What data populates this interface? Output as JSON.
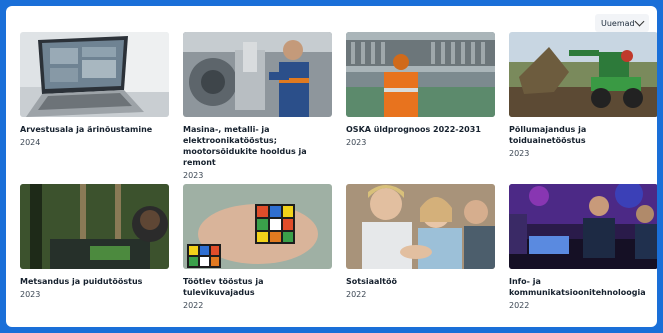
{
  "sort": {
    "label": "Uuemad"
  },
  "cards": [
    {
      "title": "Arvestusala ja ärinõustamine",
      "year": "2024",
      "image_icon": "laptop-dashboard-image"
    },
    {
      "title": "Masina-, metalli- ja elektroonikatööstus; mootorsõidukite hooldus ja remont",
      "year": "2023",
      "image_icon": "mechanic-image"
    },
    {
      "title": "OSKA üldprognoos 2022-2031",
      "year": "2023",
      "image_icon": "industrial-worker-image"
    },
    {
      "title": "Põllumajandus ja toiduainetööstus",
      "year": "2023",
      "image_icon": "tractor-image"
    },
    {
      "title": "Metsandus ja puidutööstus",
      "year": "2023",
      "image_icon": "forestry-machine-image"
    },
    {
      "title": "Töötlev tööstus ja tulevikuvajadus",
      "year": "2022",
      "image_icon": "rubiks-cube-image"
    },
    {
      "title": "Sotsiaaltöö",
      "year": "2022",
      "image_icon": "family-image"
    },
    {
      "title": "Info- ja kommunikatsioonitehnoloogia",
      "year": "2022",
      "image_icon": "gaming-event-image"
    }
  ]
}
